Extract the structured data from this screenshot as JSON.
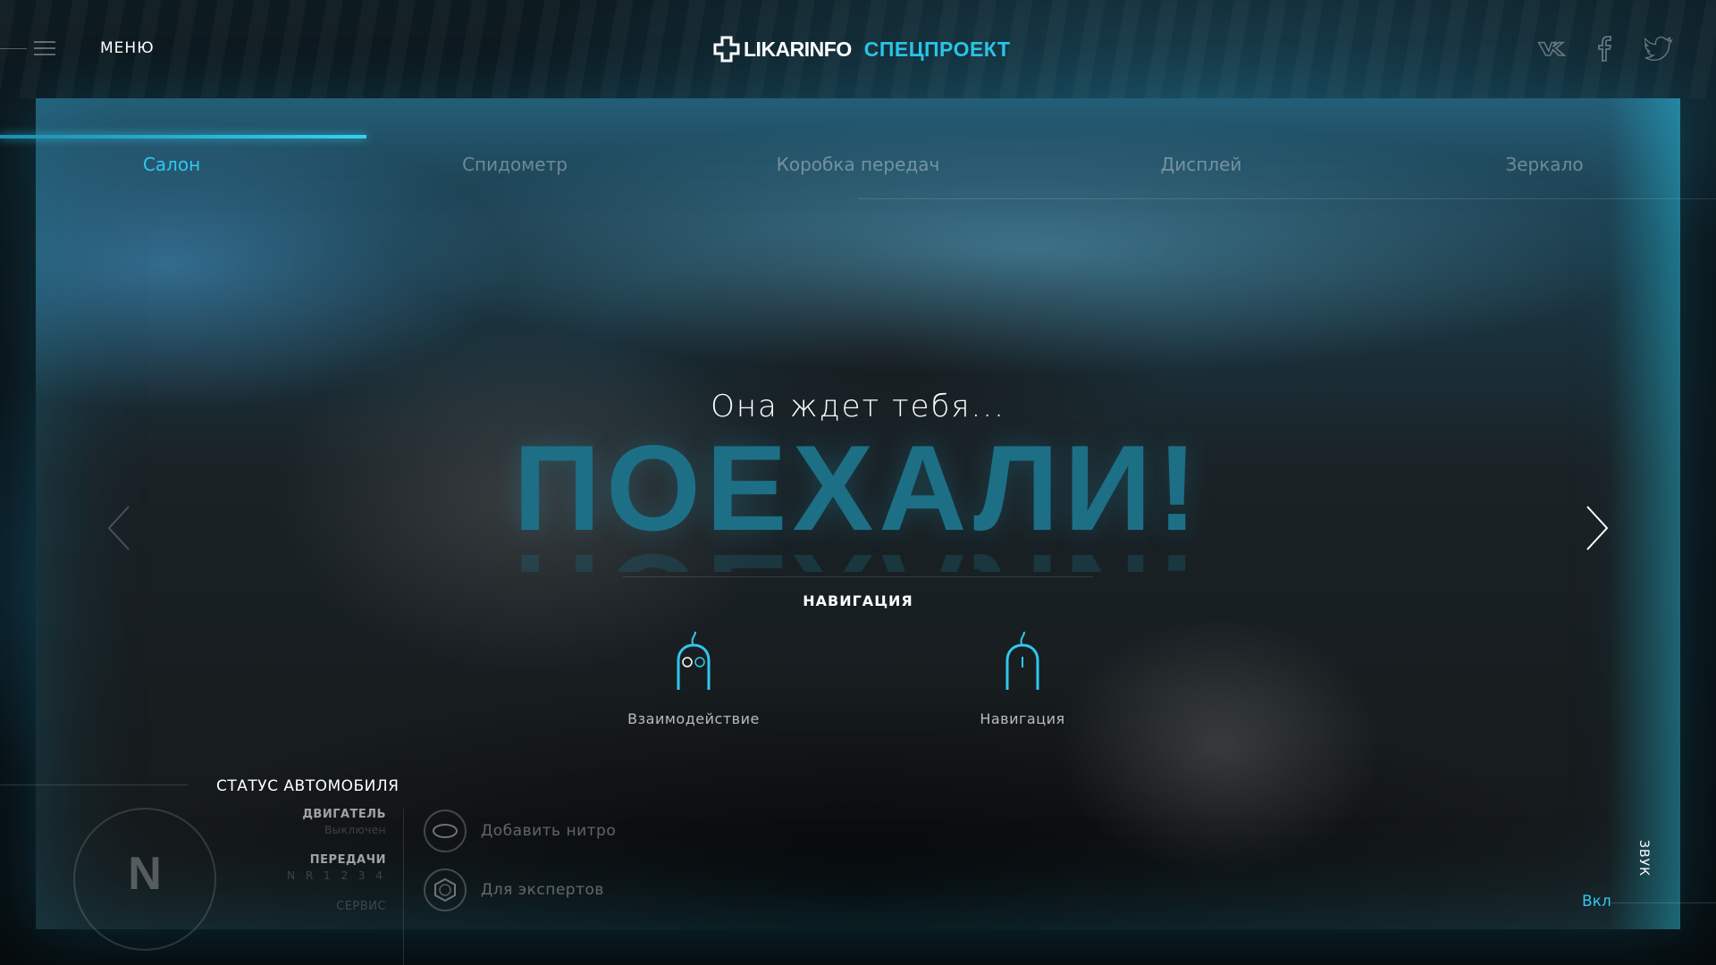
{
  "header": {
    "menu_label": "МЕНЮ",
    "logo_text": "LIKARINFO",
    "logo_sub": "СПЕЦПРОЕКТ",
    "social_icons": [
      "vk-icon",
      "facebook-icon",
      "twitter-icon"
    ]
  },
  "tabs": [
    {
      "label": "Салон",
      "active": true
    },
    {
      "label": "Спидометр",
      "active": false
    },
    {
      "label": "Коробка передач",
      "active": false
    },
    {
      "label": "Дисплей",
      "active": false
    },
    {
      "label": "Зеркало",
      "active": false
    }
  ],
  "hero": {
    "subtitle": "Она ждет тебя...",
    "title": "ПОЕХАЛИ!"
  },
  "navigation": {
    "title": "НАВИГАЦИЯ",
    "items": [
      {
        "label": "Взаимодействие",
        "icon": "mouse-click-icon"
      },
      {
        "label": "Навигация",
        "icon": "mouse-scroll-icon"
      }
    ]
  },
  "status": {
    "title": "СТАТУС АВТОМОБИЛЯ",
    "gear_letter": "N",
    "engine_label": "ДВИГАТЕЛЬ",
    "engine_value": "Выключен",
    "gears_label": "ПЕРЕДАЧИ",
    "gears_value": "N R 1 2 3 4",
    "service_label": "СЕРВИС",
    "actions": [
      {
        "label": "Добавить нитро",
        "icon": "nitro-icon"
      },
      {
        "label": "Для экспертов",
        "icon": "expert-icon"
      }
    ]
  },
  "sound": {
    "label": "ЗВУК",
    "value": "Вкл"
  },
  "colors": {
    "accent": "#30c8ee",
    "hero": "#1d6f86",
    "background": "#0b1114"
  }
}
